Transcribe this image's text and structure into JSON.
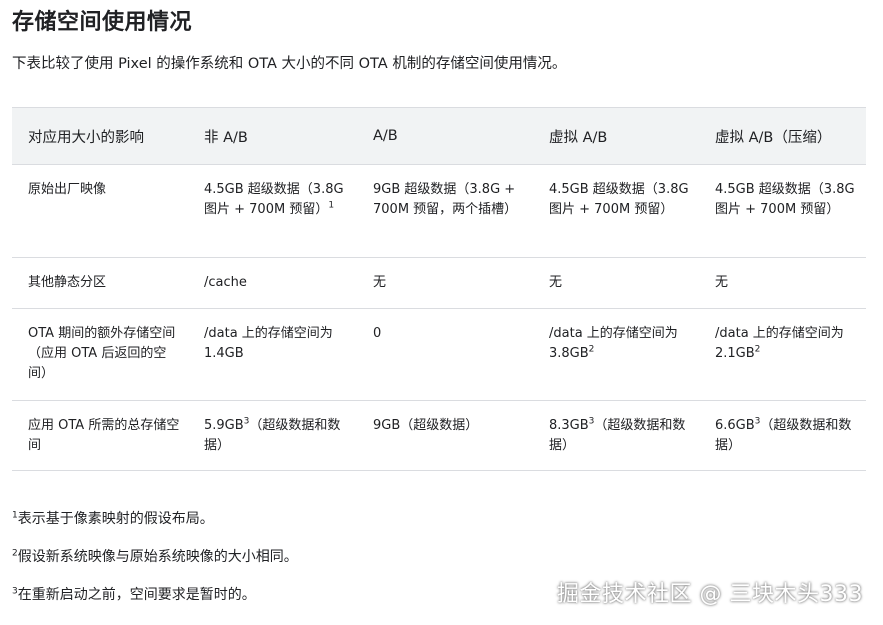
{
  "heading": "存储空间使用情况",
  "intro": "下表比较了使用 Pixel 的操作系统和 OTA 大小的不同 OTA 机制的存储空间使用情况。",
  "table": {
    "headers": [
      "对应用大小的影响",
      "非 A/B",
      "A/B",
      "虚拟 A/B",
      "虚拟 A/B（压缩）"
    ],
    "rows": [
      {
        "label": "原始出厂映像",
        "c1": "4.5GB 超级数据（3.8G 图片 + 700M 预留）",
        "c1_sup": "1",
        "c2": "9GB 超级数据（3.8G + 700M 预留，两个插槽）",
        "c2_sup": "",
        "c3": "4.5GB 超级数据（3.8G 图片 + 700M 预留）",
        "c3_sup": "",
        "c4": "4.5GB 超级数据（3.8G 图片 + 700M 预留）",
        "c4_sup": ""
      },
      {
        "label": "其他静态分区",
        "c1": "/cache",
        "c1_sup": "",
        "c2": "无",
        "c2_sup": "",
        "c3": "无",
        "c3_sup": "",
        "c4": "无",
        "c4_sup": ""
      },
      {
        "label": "OTA 期间的额外存储空间（应用 OTA 后返回的空间）",
        "c1": "/data 上的存储空间为 1.4GB",
        "c1_sup": "",
        "c2": "0",
        "c2_sup": "",
        "c3": "/data 上的存储空间为 3.8GB",
        "c3_sup": "2",
        "c4": "/data 上的存储空间为 2.1GB",
        "c4_sup": "2"
      },
      {
        "label": "应用 OTA 所需的总存储空间",
        "c1_a": "5.9GB",
        "c1_sup": "3",
        "c1_b": "（超级数据和数据）",
        "c2": "9GB（超级数据）",
        "c2_sup": "",
        "c3_a": "8.3GB",
        "c3_sup": "3",
        "c3_b": "（超级数据和数据）",
        "c4_a": "6.6GB",
        "c4_sup": "3",
        "c4_b": "（超级数据和数据）"
      }
    ]
  },
  "footnotes": [
    {
      "num": "1",
      "text": "表示基于像素映射的假设布局。"
    },
    {
      "num": "2",
      "text": "假设新系统映像与原始系统映像的大小相同。"
    },
    {
      "num": "3",
      "text": "在重新启动之前，空间要求是暂时的。"
    }
  ],
  "watermark": "掘金技术社区 @ 三块木头333"
}
